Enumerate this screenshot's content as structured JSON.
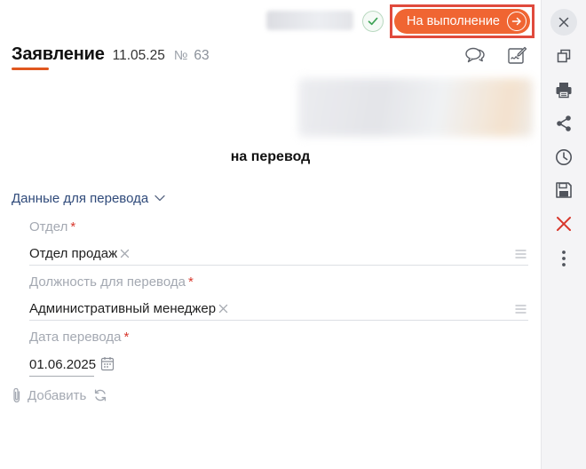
{
  "topbar": {
    "status_button": {
      "label": "На выполнение",
      "color": "#f06532"
    },
    "highlight_color": "#e04a3d",
    "confirm_icon": "check-icon"
  },
  "document": {
    "title": "Заявление",
    "date": "11.05.25",
    "number_sign": "№",
    "number": "63",
    "icons": [
      "comments-icon",
      "sign-document-icon"
    ],
    "subject": "на перевод"
  },
  "section": {
    "title": "Данные для перевода",
    "fields": [
      {
        "label": "Отдел",
        "required_mark": "*",
        "value": "Отдел продаж"
      },
      {
        "label": "Должность для перевода",
        "required_mark": "*",
        "value": "Административный менеджер"
      },
      {
        "label": "Дата перевода",
        "required_mark": "*",
        "value": "01.06.2025"
      }
    ]
  },
  "attachments": {
    "add_label": "Добавить"
  },
  "sidebar": {
    "items": [
      "close-icon",
      "copy-icon",
      "print-icon",
      "share-icon",
      "history-icon",
      "save-icon",
      "delete-icon",
      "more-icon"
    ]
  },
  "colors": {
    "accent": "#f06532",
    "section_title": "#2f4a7a",
    "required": "#d8382d",
    "delete": "#d8382d"
  }
}
